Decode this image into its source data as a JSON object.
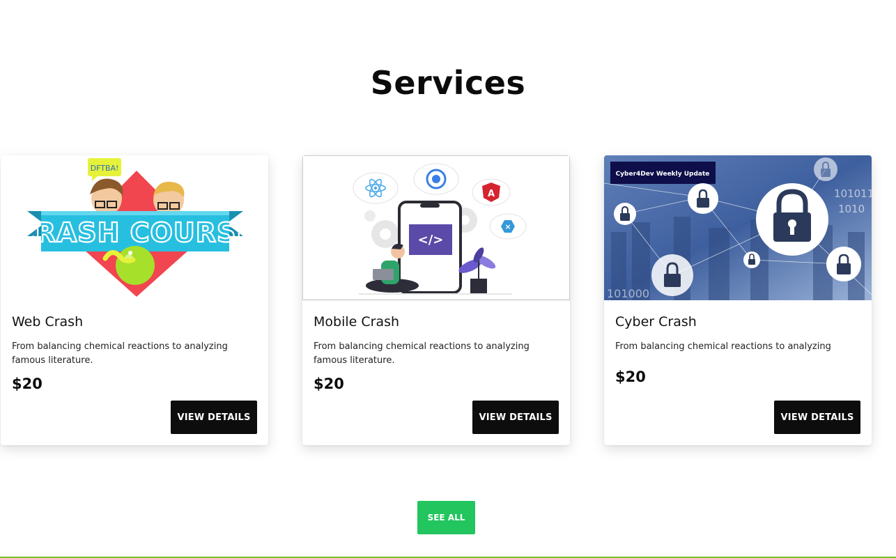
{
  "section": {
    "title": "Services"
  },
  "cards": [
    {
      "title": "Web Crash",
      "description": "From balancing chemical reactions to analyzing famous literature.",
      "price": "$20",
      "button_label": "VIEW DETAILS",
      "image": {
        "logo_text": "CRASH COURSE",
        "bubble_text": "DFTBA!"
      }
    },
    {
      "title": "Mobile Crash",
      "description": "From balancing chemical reactions to analyzing famous literature.",
      "price": "$20",
      "button_label": "VIEW DETAILS",
      "image": {
        "code_text": "</>"
      }
    },
    {
      "title": "Cyber Crash",
      "description": "From balancing chemical reactions to analyzing",
      "price": "$20",
      "button_label": "VIEW DETAILS",
      "image": {
        "banner_text": "Cyber4Dev Weekly Update",
        "binary_text": "101011",
        "binary_text_2": "1010",
        "binary_text_3": "101000"
      }
    }
  ],
  "see_all": {
    "label": "SEE ALL"
  },
  "colors": {
    "see_all_bg": "#22c55e",
    "details_bg": "#0d0d0d",
    "accent_line": "#7bbf2a"
  }
}
